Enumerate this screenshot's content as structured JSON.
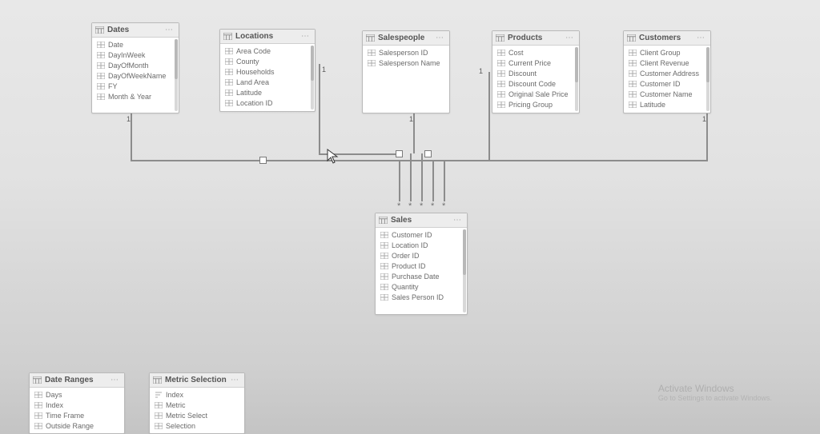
{
  "tables": {
    "dates": {
      "title": "Dates",
      "fields": [
        "Date",
        "DayInWeek",
        "DayOfMonth",
        "DayOfWeekName",
        "FY",
        "Month & Year"
      ]
    },
    "locations": {
      "title": "Locations",
      "fields": [
        "Area Code",
        "County",
        "Households",
        "Land Area",
        "Latitude",
        "Location ID"
      ]
    },
    "salespeople": {
      "title": "Salespeople",
      "fields": [
        "Salesperson ID",
        "Salesperson Name"
      ]
    },
    "products": {
      "title": "Products",
      "fields": [
        "Cost",
        "Current Price",
        "Discount",
        "Discount Code",
        "Original Sale Price",
        "Pricing Group"
      ]
    },
    "customers": {
      "title": "Customers",
      "fields": [
        "Client Group",
        "Client Revenue",
        "Customer Address",
        "Customer ID",
        "Customer Name",
        "Latitude"
      ]
    },
    "sales": {
      "title": "Sales",
      "fields": [
        "Customer ID",
        "Location ID",
        "Order ID",
        "Product ID",
        "Purchase Date",
        "Quantity",
        "Sales Person ID"
      ]
    },
    "dateranges": {
      "title": "Date Ranges",
      "fields": [
        "Days",
        "Index",
        "Time Frame",
        "Outside Range"
      ]
    },
    "metricselection": {
      "title": "Metric Selection",
      "fields": [
        "Index",
        "Metric",
        "Metric Select",
        "Selection"
      ]
    }
  },
  "cardinality": {
    "one": "1",
    "many": "*"
  },
  "watermark": {
    "title": "Activate Windows",
    "sub": "Go to Settings to activate Windows."
  },
  "menu_dots": "⋯"
}
